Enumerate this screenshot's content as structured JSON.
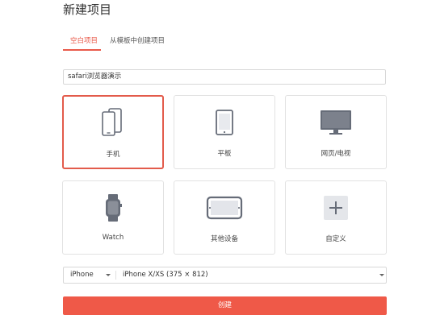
{
  "page": {
    "title": "新建项目"
  },
  "tabs": [
    {
      "label": "空白项目",
      "active": true
    },
    {
      "label": "从模板中创建项目",
      "active": false
    }
  ],
  "project_name": {
    "value": "safari浏览器演示"
  },
  "devices": [
    {
      "label": "手机",
      "icon": "phone-icon",
      "selected": true
    },
    {
      "label": "平板",
      "icon": "tablet-icon",
      "selected": false
    },
    {
      "label": "网页/电视",
      "icon": "monitor-icon",
      "selected": false
    },
    {
      "label": "Watch",
      "icon": "watch-icon",
      "selected": false
    },
    {
      "label": "其他设备",
      "icon": "other-device-icon",
      "selected": false
    },
    {
      "label": "自定义",
      "icon": "plus-icon",
      "selected": false
    }
  ],
  "device_select": {
    "platform": "iPhone",
    "model": "iPhone X/XS (375 × 812)"
  },
  "create_button": {
    "label": "创建"
  },
  "colors": {
    "accent": "#ef5948",
    "icon": "#666c78"
  }
}
